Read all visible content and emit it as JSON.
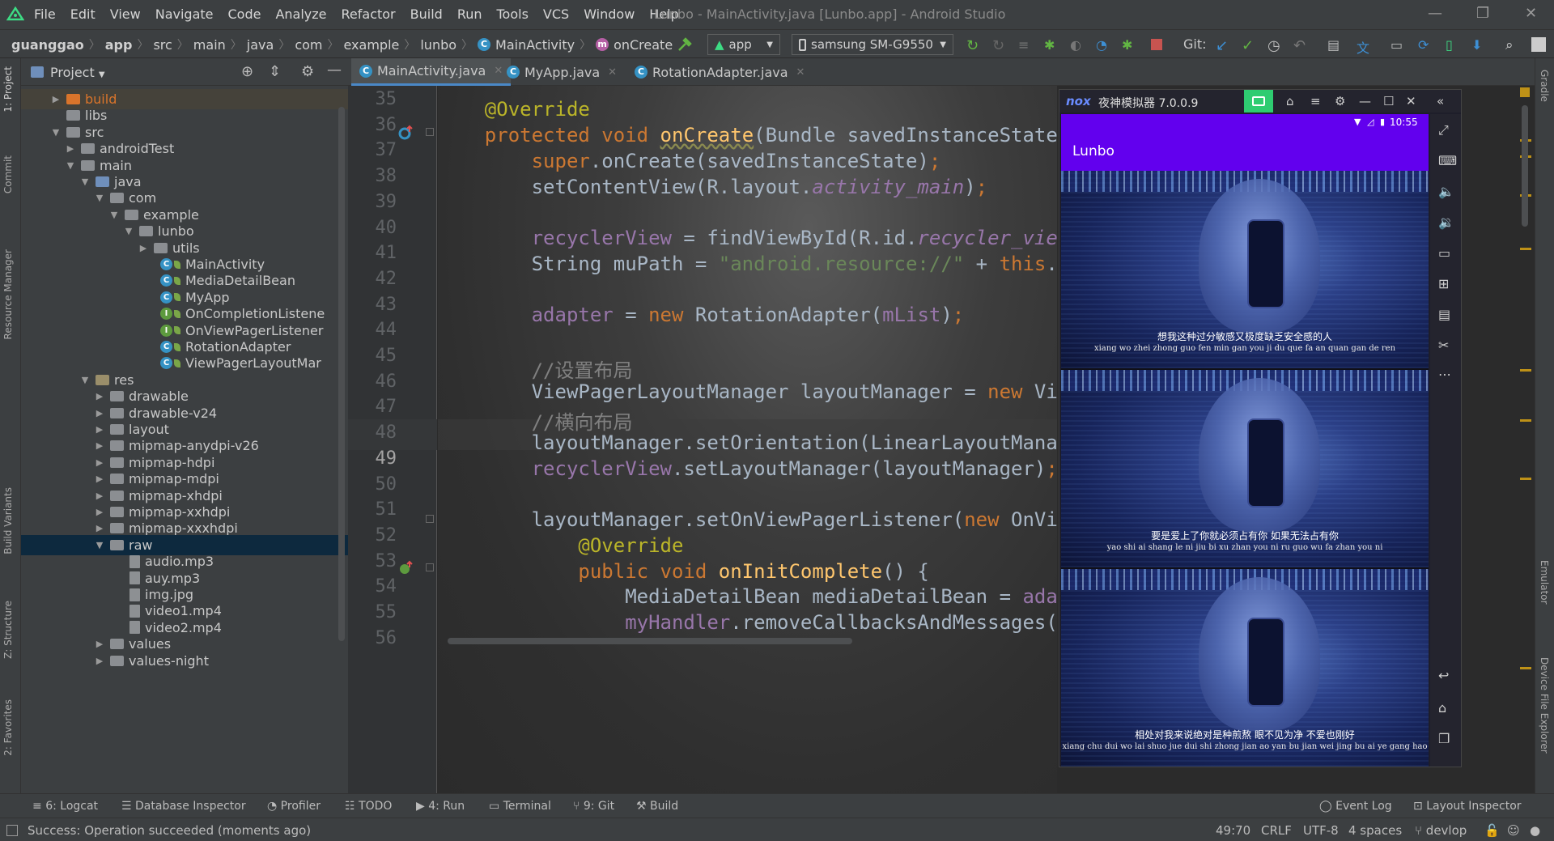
{
  "menubar": {
    "items": [
      "File",
      "Edit",
      "View",
      "Navigate",
      "Code",
      "Analyze",
      "Refactor",
      "Build",
      "Run",
      "Tools",
      "VCS",
      "Window",
      "Help"
    ],
    "window_title": "Lunbo - MainActivity.java [Lunbo.app] - Android Studio"
  },
  "navbar": {
    "crumbs": [
      "guanggao",
      "app",
      "src",
      "main",
      "java",
      "com",
      "example",
      "lunbo",
      "MainActivity",
      "onCreate"
    ],
    "run_config": "app",
    "device": "samsung SM-G9550",
    "git_label": "Git:"
  },
  "left_strip": {
    "project": "1: Project",
    "commit": "Commit",
    "resource_manager": "Resource Manager",
    "build_variants": "Build Variants",
    "structure": "Z: Structure",
    "favorites": "2: Favorites"
  },
  "right_strip": {
    "gradle": "Gradle",
    "emulator": "Emulator",
    "device_explorer": "Device File Explorer"
  },
  "project_panel": {
    "title": "Project",
    "tree": [
      {
        "label": "build",
        "kind": "folder-orange",
        "depth": 1,
        "arrow": "▶"
      },
      {
        "label": "libs",
        "kind": "folder",
        "depth": 1,
        "arrow": ""
      },
      {
        "label": "src",
        "kind": "folder",
        "depth": 1,
        "arrow": "▼"
      },
      {
        "label": "androidTest",
        "kind": "folder",
        "depth": 2,
        "arrow": "▶"
      },
      {
        "label": "main",
        "kind": "folder",
        "depth": 2,
        "arrow": "▼"
      },
      {
        "label": "java",
        "kind": "folder-java",
        "depth": 3,
        "arrow": "▼"
      },
      {
        "label": "com",
        "kind": "folder",
        "depth": 4,
        "arrow": "▼"
      },
      {
        "label": "example",
        "kind": "folder",
        "depth": 5,
        "arrow": "▼"
      },
      {
        "label": "lunbo",
        "kind": "folder",
        "depth": 6,
        "arrow": "▼"
      },
      {
        "label": "utils",
        "kind": "folder",
        "depth": 7,
        "arrow": "▶"
      },
      {
        "label": "MainActivity",
        "kind": "class",
        "depth": 7,
        "arrow": ""
      },
      {
        "label": "MediaDetailBean",
        "kind": "class",
        "depth": 7,
        "arrow": ""
      },
      {
        "label": "MyApp",
        "kind": "class",
        "depth": 7,
        "arrow": ""
      },
      {
        "label": "OnCompletionListene",
        "kind": "interface",
        "depth": 7,
        "arrow": ""
      },
      {
        "label": "OnViewPagerListener",
        "kind": "interface",
        "depth": 7,
        "arrow": ""
      },
      {
        "label": "RotationAdapter",
        "kind": "class",
        "depth": 7,
        "arrow": ""
      },
      {
        "label": "ViewPagerLayoutMar",
        "kind": "class",
        "depth": 7,
        "arrow": ""
      },
      {
        "label": "res",
        "kind": "folder-res",
        "depth": 3,
        "arrow": "▼"
      },
      {
        "label": "drawable",
        "kind": "folder",
        "depth": 4,
        "arrow": "▶"
      },
      {
        "label": "drawable-v24",
        "kind": "folder",
        "depth": 4,
        "arrow": "▶"
      },
      {
        "label": "layout",
        "kind": "folder",
        "depth": 4,
        "arrow": "▶"
      },
      {
        "label": "mipmap-anydpi-v26",
        "kind": "folder",
        "depth": 4,
        "arrow": "▶"
      },
      {
        "label": "mipmap-hdpi",
        "kind": "folder",
        "depth": 4,
        "arrow": "▶"
      },
      {
        "label": "mipmap-mdpi",
        "kind": "folder",
        "depth": 4,
        "arrow": "▶"
      },
      {
        "label": "mipmap-xhdpi",
        "kind": "folder",
        "depth": 4,
        "arrow": "▶"
      },
      {
        "label": "mipmap-xxhdpi",
        "kind": "folder",
        "depth": 4,
        "arrow": "▶"
      },
      {
        "label": "mipmap-xxxhdpi",
        "kind": "folder",
        "depth": 4,
        "arrow": "▶"
      },
      {
        "label": "raw",
        "kind": "folder",
        "depth": 4,
        "arrow": "▼"
      },
      {
        "label": "audio.mp3",
        "kind": "file",
        "depth": 5,
        "arrow": ""
      },
      {
        "label": "auy.mp3",
        "kind": "file",
        "depth": 5,
        "arrow": ""
      },
      {
        "label": "img.jpg",
        "kind": "file",
        "depth": 5,
        "arrow": ""
      },
      {
        "label": "video1.mp4",
        "kind": "file",
        "depth": 5,
        "arrow": ""
      },
      {
        "label": "video2.mp4",
        "kind": "file",
        "depth": 5,
        "arrow": ""
      },
      {
        "label": "values",
        "kind": "folder",
        "depth": 4,
        "arrow": "▶"
      },
      {
        "label": "values-night",
        "kind": "folder",
        "depth": 4,
        "arrow": "▶"
      }
    ]
  },
  "editor": {
    "tabs": [
      {
        "label": "MainActivity.java",
        "active": true
      },
      {
        "label": "MyApp.java",
        "active": false
      },
      {
        "label": "RotationAdapter.java",
        "active": false
      }
    ],
    "line_numbers": [
      "35",
      "36",
      "37",
      "38",
      "39",
      "40",
      "41",
      "42",
      "43",
      "44",
      "45",
      "46",
      "47",
      "48",
      "49",
      "50",
      "51",
      "52",
      "53",
      "54",
      "55",
      "56"
    ],
    "current_line": "49"
  },
  "emulator": {
    "brand": "nox",
    "title": "夜神模拟器 7.0.0.9",
    "status_time": "10:55",
    "app_title": "Lunbo",
    "frames": [
      {
        "sub_cn": "想我这种过分敏感又极度缺乏安全感的人",
        "sub_py": "xiang wo zhei zhong guo fen min gan you ji du que fa an quan gan de ren"
      },
      {
        "sub_cn": "要是爱上了你就必须占有你 如果无法占有你",
        "sub_py": "yao shi ai shang le ni jiu bi xu zhan you ni ru guo wu fa zhan you ni"
      },
      {
        "sub_cn": "相处对我来说绝对是种煎熬 眼不见为净 不爱也刚好",
        "sub_py": "xiang chu dui wo lai shuo jue dui shi zhong jian ao yan bu jian wei jing bu ai ye gang hao"
      }
    ]
  },
  "bottom_tools": [
    "6: Logcat",
    "Database Inspector",
    "Profiler",
    "TODO",
    "4: Run",
    "Terminal",
    "9: Git",
    "Build"
  ],
  "bottom_right_tools": [
    "Event Log",
    "Layout Inspector"
  ],
  "status": {
    "message": "Success: Operation succeeded (moments ago)",
    "position": "49:70",
    "line_sep": "CRLF",
    "encoding": "UTF-8",
    "indent": "4 spaces",
    "branch": "devlop"
  },
  "colors": {
    "ide_bg": "#2b2b2b",
    "panel_bg": "#3c3f41",
    "keyword": "#cc7832",
    "annotation": "#bbb529",
    "method": "#ffc66d",
    "field": "#9876aa",
    "string": "#6a8759",
    "comment": "#808080",
    "emulator_appbar": "#6200ee"
  }
}
